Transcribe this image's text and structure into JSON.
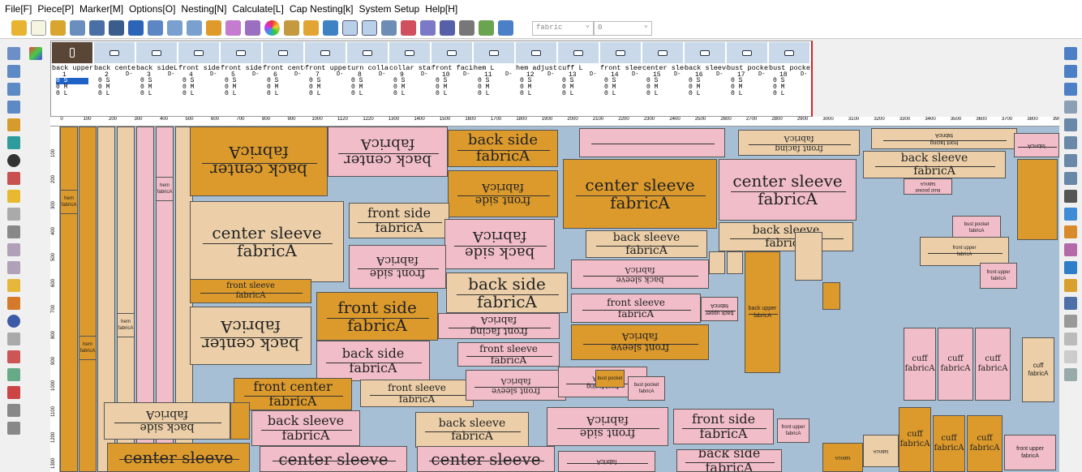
{
  "menu": [
    "File[F]",
    "Piece[P]",
    "Marker[M]",
    "Options[O]",
    "Nesting[N]",
    "Calculate[L]",
    "Cap Nesting[k]",
    "System Setup",
    "Help[H]"
  ],
  "toolbar": {
    "fabric_value": "fabric",
    "second_value": "0"
  },
  "pieces": [
    {
      "name": "back upper",
      "num": "1",
      "d": ""
    },
    {
      "name": "back center",
      "num": "2",
      "d": "D-"
    },
    {
      "name": "back sideL",
      "num": "3",
      "d": "D-"
    },
    {
      "name": "front side",
      "num": "4",
      "d": "D-"
    },
    {
      "name": "front side",
      "num": "5",
      "d": "D-"
    },
    {
      "name": "front center",
      "num": "6",
      "d": "D-"
    },
    {
      "name": "front upper",
      "num": "7",
      "d": "D-"
    },
    {
      "name": "turn collar",
      "num": "8",
      "d": "D-"
    },
    {
      "name": "collar stand",
      "num": "9",
      "d": "D-"
    },
    {
      "name": "front facing",
      "num": "10",
      "d": "D-"
    },
    {
      "name": "hem L",
      "num": "11",
      "d": "D-"
    },
    {
      "name": "hem adjust",
      "num": "12",
      "d": "D-"
    },
    {
      "name": "cuff L",
      "num": "13",
      "d": "D-"
    },
    {
      "name": "front sleeve",
      "num": "14",
      "d": "D-"
    },
    {
      "name": "center sleeve",
      "num": "15",
      "d": "D-"
    },
    {
      "name": "back sleeve",
      "num": "16",
      "d": "D-"
    },
    {
      "name": "bust pocket",
      "num": "17",
      "d": "D-"
    },
    {
      "name": "bust pocket",
      "num": "18",
      "d": "D-"
    }
  ],
  "sizes": [
    "0 S",
    "0 M",
    "0 L"
  ],
  "ruler_top": [
    "0",
    "100",
    "200",
    "300",
    "400",
    "500",
    "600",
    "700",
    "800",
    "900",
    "1000",
    "1120",
    "1220",
    "1300",
    "1400",
    "1500",
    "1600",
    "1700",
    "1800",
    "1900",
    "2000",
    "2100",
    "2200",
    "2300",
    "2400",
    "2500",
    "2600",
    "2700",
    "2800",
    "2900",
    "3000",
    "3100",
    "3200",
    "3300",
    "3400",
    "3500",
    "3600",
    "3700",
    "3800",
    "3900"
  ],
  "ruler_left": [
    "1300",
    "1200",
    "1100",
    "1000",
    "900",
    "800",
    "700",
    "600",
    "500",
    "400",
    "300",
    "200",
    "100"
  ],
  "marker_labels": {
    "fabric_inv": "fabricA",
    "back_center": "back center",
    "back_side": "back side",
    "fabricA": "fabricA",
    "center_sleeve": "center sleeve",
    "front_side": "front side",
    "back_sleeve": "back sleeve",
    "front_sleeve": "front sleeve",
    "front_center": "front center",
    "front_facing": "front facing",
    "hem": "hem",
    "cuff": "cuff",
    "back_upper": "back upper",
    "bust_pocket": "bust pocket",
    "front_upper": "front upper"
  }
}
